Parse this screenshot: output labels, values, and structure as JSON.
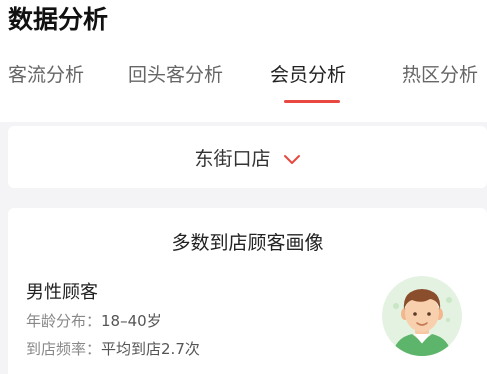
{
  "header": {
    "title": "数据分析"
  },
  "tabs": [
    {
      "label": "客流分析",
      "active": false
    },
    {
      "label": "回头客分析",
      "active": false
    },
    {
      "label": "会员分析",
      "active": true
    },
    {
      "label": "热区分析",
      "active": false
    }
  ],
  "store_selector": {
    "value": "东街口店",
    "icon": "chevron-down-icon"
  },
  "profile": {
    "title": "多数到店顾客画像",
    "segment": "男性顾客",
    "age_label": "年龄分布：",
    "age_value": "18–40岁",
    "freq_label": "到店频率：",
    "freq_value": "平均到店2.7次",
    "avatar_icon": "male-customer-avatar"
  },
  "colors": {
    "accent": "#e8483f",
    "background": "#f4f4f6",
    "card": "#ffffff",
    "avatar_bg": "#e4f2e2",
    "shirt": "#5cb56a"
  }
}
